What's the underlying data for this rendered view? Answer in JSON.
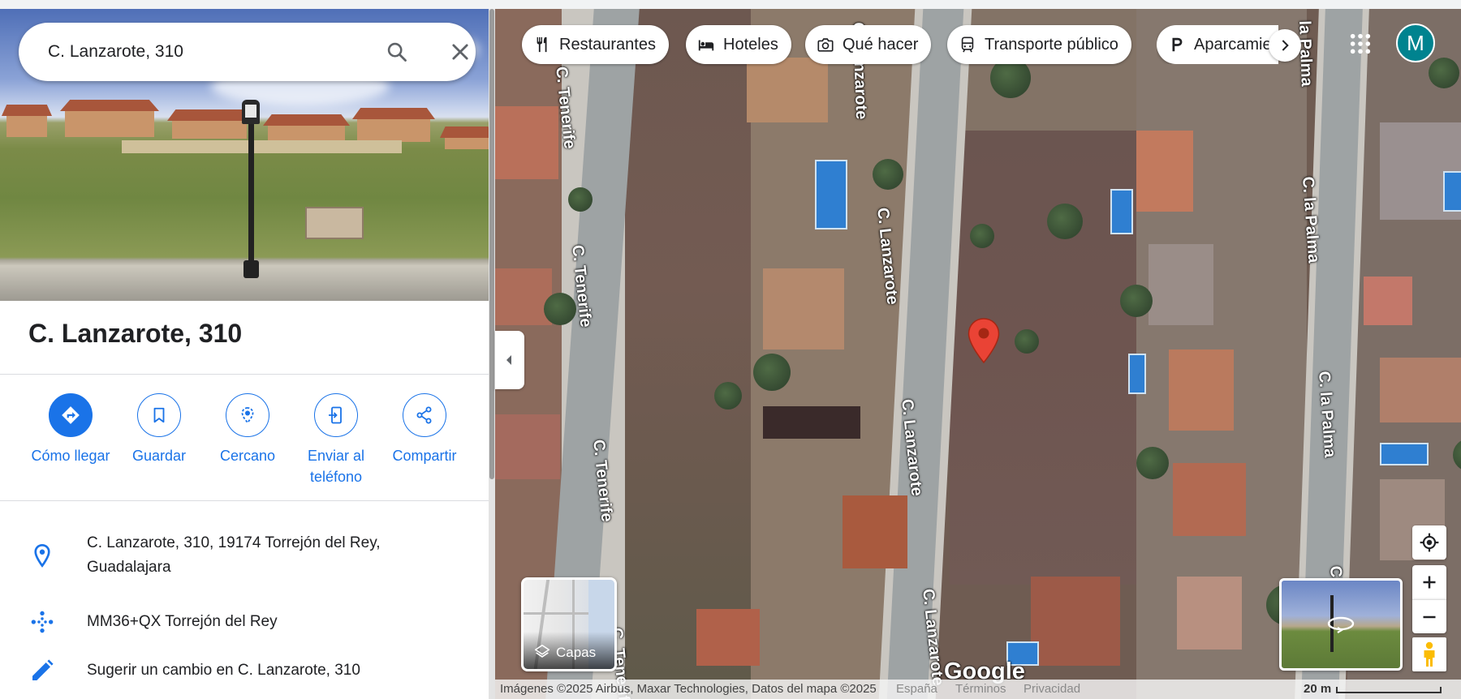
{
  "search": {
    "query": "C. Lanzarote, 310"
  },
  "place": {
    "title": "C. Lanzarote, 310",
    "actions": [
      {
        "label": "Cómo llegar",
        "icon": "directions-icon"
      },
      {
        "label": "Guardar",
        "icon": "bookmark-icon"
      },
      {
        "label": "Cercano",
        "icon": "nearby-icon"
      },
      {
        "label": "Enviar al teléfono",
        "icon": "send-to-phone-icon"
      },
      {
        "label": "Compartir",
        "icon": "share-icon"
      }
    ],
    "info": [
      {
        "text": "C. Lanzarote, 310, 19174 Torrejón del Rey, Guadalajara",
        "icon": "location-pin-icon"
      },
      {
        "text": "MM36+QX Torrejón del Rey",
        "icon": "plus-code-icon"
      },
      {
        "text": "Sugerir un cambio en C. Lanzarote, 310",
        "icon": "pencil-icon"
      }
    ]
  },
  "map": {
    "chips": [
      {
        "label": "Restaurantes",
        "icon": "restaurant-icon"
      },
      {
        "label": "Hoteles",
        "icon": "hotel-icon"
      },
      {
        "label": "Qué hacer",
        "icon": "camera-icon"
      },
      {
        "label": "Transporte público",
        "icon": "transit-icon"
      },
      {
        "label": "Aparcamientos",
        "icon": "parking-icon"
      }
    ],
    "account_initial": "M",
    "streets": {
      "lanzarote_top": "C. Lanzarote",
      "lanzarote_mid": "C. Lanzarote",
      "lanzarote_low": "C. Lanzarote",
      "lanzarote_bottom": "C. Lanzarote",
      "tenerife_top": "C. Tenerife",
      "tenerife_mid": "C. Tenerife",
      "tenerife_low": "C. Tenerife",
      "tenerife_bottom": "C. Tenerife",
      "palma_top": "la Palma",
      "palma_mid": "C. la Palma",
      "palma_low": "C. la Palma",
      "palma_bottom": "C"
    },
    "layers_label": "Capas",
    "logo": "Google",
    "footer": {
      "imagery": "Imágenes ©2025 Airbus, Maxar Technologies, Datos del mapa ©2025",
      "country": "España",
      "terms": "Términos",
      "privacy": "Privacidad",
      "scale": "20 m"
    },
    "colors": {
      "accent": "#1a73e8",
      "pin": "#ea4335",
      "avatar": "#00838f"
    }
  }
}
